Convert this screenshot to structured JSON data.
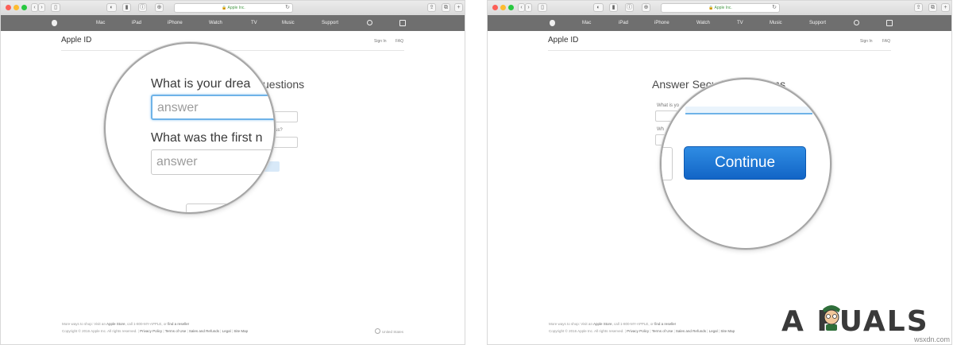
{
  "browser": {
    "url": "Apple Inc.",
    "reload_icon": "reload-icon"
  },
  "nav": {
    "items": [
      "Mac",
      "iPad",
      "iPhone",
      "Watch",
      "TV",
      "Music",
      "Support"
    ]
  },
  "subheader": {
    "title": "Apple ID",
    "sign_in": "Sign In",
    "faq": "FAQ"
  },
  "left": {
    "heading_partial": "uestions",
    "hint_partial": "oss?",
    "magnifier": {
      "question1": "What is your drea",
      "answer_placeholder": "answer",
      "question2": "What was the first n",
      "answer2_placeholder": "answer"
    }
  },
  "right": {
    "heading": "Answer Security Questions",
    "label1_partial": "What is yo",
    "label2_partial": "Wh",
    "magnifier": {
      "continue_label": "Continue"
    }
  },
  "footer": {
    "line1_a": "More ways to shop: Visit an",
    "line1_store": "Apple Store",
    "line1_b": ", call 1-800-MY-APPLE, or",
    "line1_reseller": "find a reseller",
    "copyright": "Copyright © 2016 Apple Inc. All rights reserved.",
    "links": [
      "Privacy Policy",
      "Terms of Use",
      "Sales and Refunds",
      "Legal",
      "Site Map"
    ],
    "country": "United States"
  },
  "watermark": {
    "brand": "A  PUALS",
    "site": "wsxdn.com"
  },
  "colors": {
    "navbar": "#6f6f6f",
    "continue_button": "#1f78d6",
    "input_focus": "#6fb3e8"
  }
}
